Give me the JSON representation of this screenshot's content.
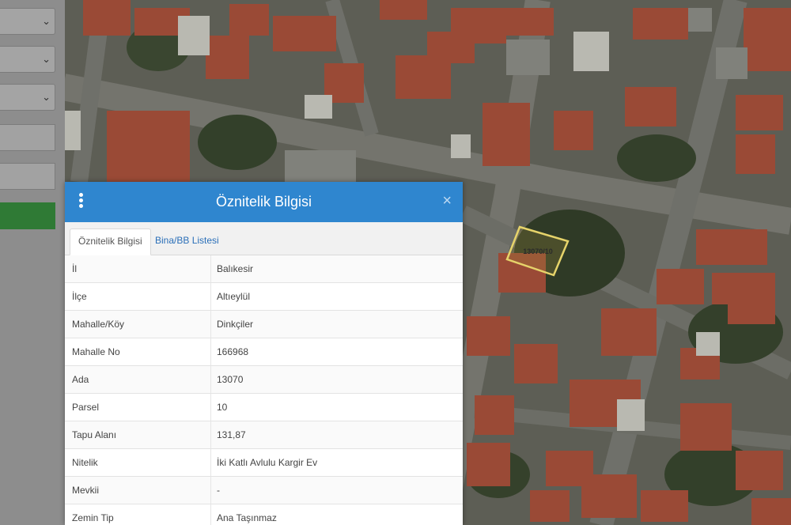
{
  "map": {
    "parcel_label": "13070/10"
  },
  "left_panel": {
    "selects": [
      {
        "icon": "chevron-down-icon"
      },
      {
        "icon": "chevron-down-icon"
      },
      {
        "icon": "chevron-down-icon"
      }
    ]
  },
  "dialog": {
    "title": "Öznitelik Bilgisi",
    "close_symbol": "×",
    "menu_icon": "vertical-dots-icon",
    "header_color": "#2f86cf",
    "tabs": [
      {
        "label": "Öznitelik Bilgisi",
        "active": true
      },
      {
        "label": "Bina/BB Listesi",
        "active": false
      }
    ],
    "rows": [
      {
        "key": "İl",
        "value": "Balıkesir"
      },
      {
        "key": "İlçe",
        "value": "Altıeylül"
      },
      {
        "key": "Mahalle/Köy",
        "value": "Dinkçiler"
      },
      {
        "key": "Mahalle No",
        "value": "166968"
      },
      {
        "key": "Ada",
        "value": "13070"
      },
      {
        "key": "Parsel",
        "value": "10"
      },
      {
        "key": "Tapu Alanı",
        "value": "131,87"
      },
      {
        "key": "Nitelik",
        "value": "İki Katlı Avlulu Kargir Ev"
      },
      {
        "key": "Mevkii",
        "value": "-"
      },
      {
        "key": "Zemin Tip",
        "value": "Ana Taşınmaz"
      }
    ]
  }
}
